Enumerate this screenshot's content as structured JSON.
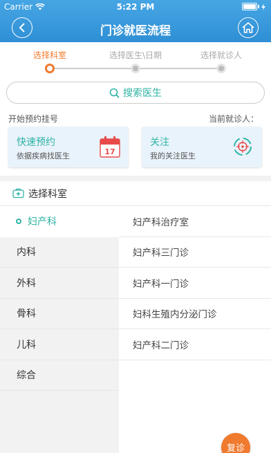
{
  "status_bar": {
    "carrier": "Carrier",
    "time": "5:22 PM"
  },
  "nav": {
    "title": "门诊就医流程"
  },
  "steps": [
    {
      "label": "选择科室",
      "active": true
    },
    {
      "label": "选择医生\\日期",
      "active": false
    },
    {
      "label": "选择就诊人",
      "active": false
    }
  ],
  "search": {
    "label": "搜索医生"
  },
  "quick": {
    "left_label": "开始预约挂号",
    "right_label": "当前就诊人：",
    "cards": [
      {
        "title": "快速预约",
        "subtitle": "依据疾病找医生",
        "icon": "calendar-icon",
        "icon_text": "17"
      },
      {
        "title": "关注",
        "subtitle": "我的关注医生",
        "icon": "target-icon"
      }
    ]
  },
  "section": {
    "title": "选择科室"
  },
  "departments": [
    "妇产科",
    "内科",
    "外科",
    "骨科",
    "儿科",
    "综合"
  ],
  "clinics": [
    "妇产科治疗室",
    "妇产科三门诊",
    "妇产科一门诊",
    "妇科生殖内分泌门诊",
    "妇产科二门诊"
  ],
  "fab": {
    "label": "复诊"
  },
  "colors": {
    "accent": "#2fb3a4",
    "orange": "#f07a2e",
    "header": "#3a9be0"
  }
}
